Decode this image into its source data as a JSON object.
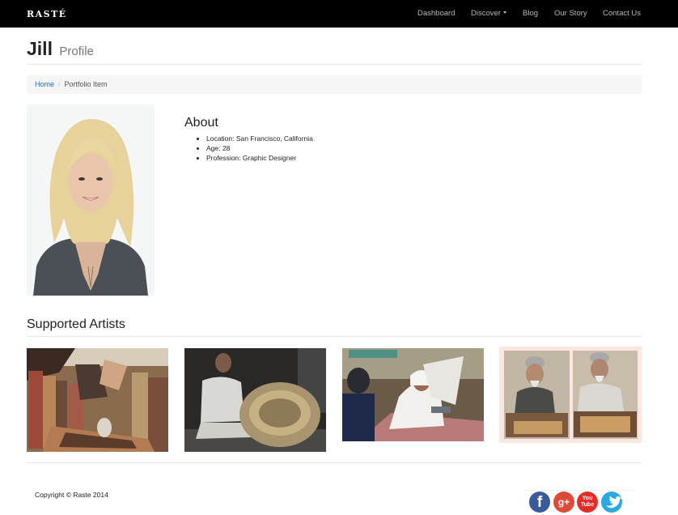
{
  "navbar": {
    "brand": "RASTÉ",
    "links": [
      {
        "label": "Dashboard"
      },
      {
        "label": "Discover"
      },
      {
        "label": "Blog"
      },
      {
        "label": "Our Story"
      },
      {
        "label": "Contact Us"
      }
    ]
  },
  "header": {
    "name": "Jill",
    "subtitle": "Profile"
  },
  "breadcrumb": {
    "home": "Home",
    "separator": "/",
    "current": "Portfolio Item"
  },
  "about": {
    "heading": "About",
    "items": [
      "Location: San Francisco, California",
      "Age: 28",
      "Profession: Graphic Designer"
    ]
  },
  "artists": {
    "heading": "Supported Artists"
  },
  "footer": {
    "copyright": "Copyright © Raste 2014",
    "social": {
      "facebook": "f",
      "googleplus": "g+",
      "youtube_top": "You",
      "youtube_bottom": "Tube"
    }
  },
  "colors": {
    "navbar": "#000000",
    "link": "#2a6ab0",
    "facebook": "#3b5a9b",
    "googleplus": "#dc4a38",
    "youtube": "#e52d27",
    "twitter": "#2aa9e0"
  }
}
